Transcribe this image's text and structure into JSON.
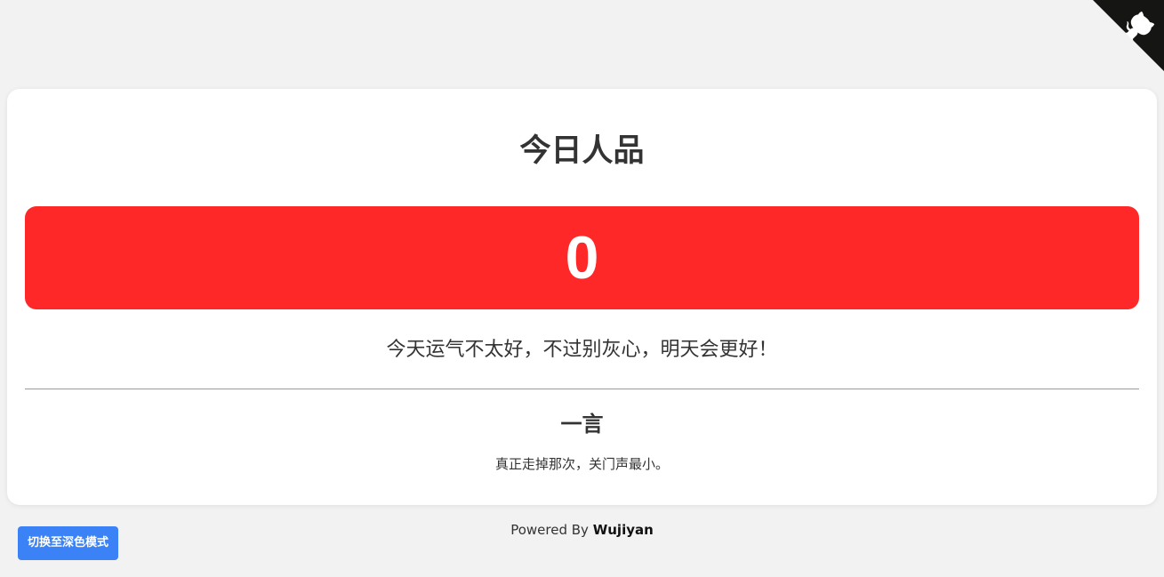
{
  "page": {
    "background": "#f2f2f2"
  },
  "github_corner": {
    "icon": "github-octocat-icon",
    "color": "#151513"
  },
  "card": {
    "title": "今日人品",
    "score": "0",
    "score_color": "#ff2828",
    "message": "今天运气不太好，不过别灰心，明天会更好！",
    "hitokoto": {
      "title": "一言",
      "text": "真正走掉那次，关门声最小。"
    }
  },
  "footer": {
    "powered_prefix": "Powered By",
    "author": "Wujiyan"
  },
  "theme_toggle": {
    "label": "切换至深色模式",
    "color": "#3b82f6"
  }
}
